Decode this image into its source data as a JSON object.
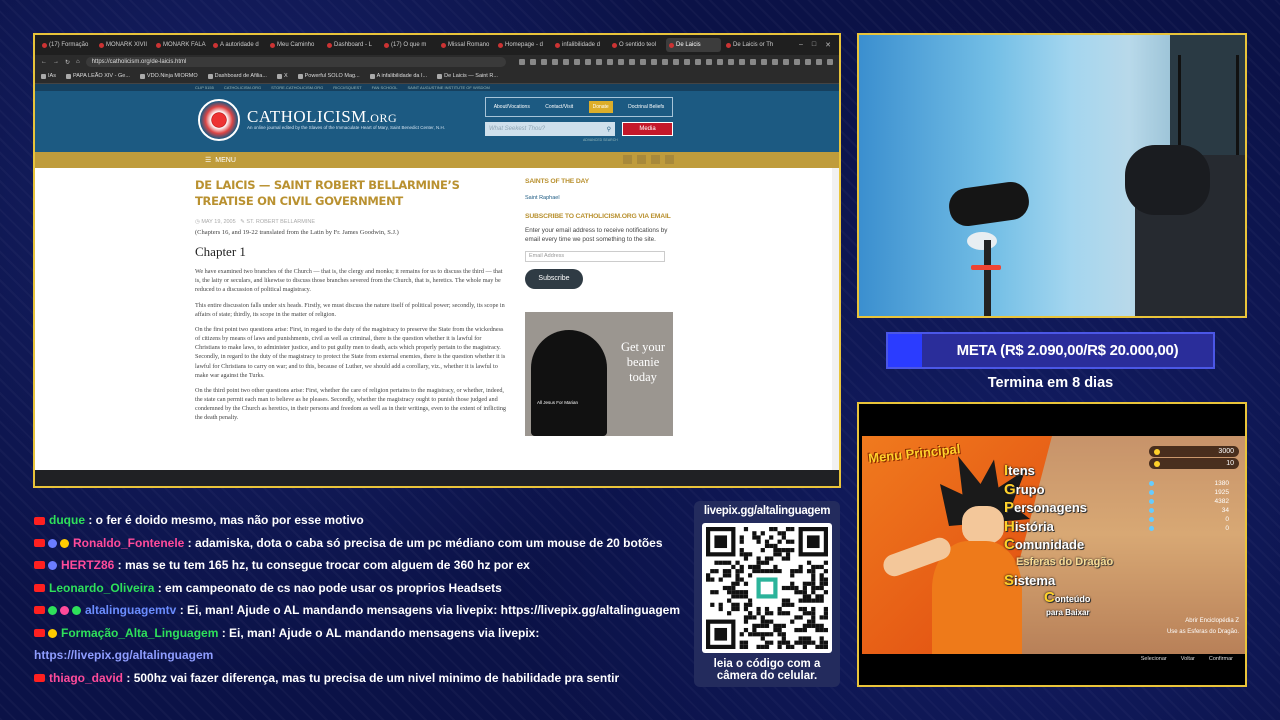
{
  "browser": {
    "tabs": [
      "(17) Formação",
      "MONARK XIVII",
      "MONARK FALA",
      "A autoridade d",
      "Meu Caminho",
      "Dashboard - L",
      "(17) O que m",
      "Missal Romano",
      "Homepage - d",
      "infalibilidade d",
      "O sentido teol",
      "De Laicis",
      "De Laicis or Th"
    ],
    "active_tab_index": 11,
    "url": "https://catholicism.org/de-laicis.html",
    "bookmarks": [
      "IAs",
      "PAPA LEÃO XIV - Ge...",
      "VDO.Ninja MIORMO",
      "Dashboard de Afilia...",
      "X",
      "Powerful SOLO Mag...",
      "A infalibilidade da I...",
      "De Laicis — Saint R..."
    ]
  },
  "site": {
    "top_links": [
      "CLIP 5155",
      "CATHOLICISM.ORG",
      "STORE.CATHOLICISM.ORG",
      "RICCI/SQUEST",
      "FAN SCHOOL",
      "SAINT AUGUSTINE INSTITUTE OF WISDOM"
    ],
    "logo_main": "CATHOLICISM",
    "logo_suffix": ".ORG",
    "logo_sub": "An online journal edited by the Slaves of the Immaculate Heart of Mary, Saint Benedict Center, N.H.",
    "nav": [
      "About/Vocations",
      "Contact/Visit",
      "Donate",
      "Doctrinal Beliefs"
    ],
    "search_placeholder": "What Seekest Thou?",
    "media_label": "Media",
    "advanced_search": "ADVANCED SEARCH",
    "menu_label": "MENU",
    "article": {
      "title": "De Laicis — Saint Robert Bellarmine’s Treatise on Civil Government",
      "date": "MAY 19, 2005",
      "author": "ST. ROBERT BELLARMINE",
      "translation": "(Chapters 16, and 19-22 translated from the Latin by Fr. James Goodwin, S.J.)",
      "chapter": "Chapter 1",
      "paragraphs": [
        "We have examined two branches of the Church — that is, the clergy and monks; it remains for us to discuss the third — that is, the laity or seculars, and likewise to discuss those branches severed from the Church, that is, heretics. The whole may be reduced to a discussion of political magistracy.",
        "This entire discussion falls under six heads. Firstly, we must discuss the nature itself of political power; secondly, its scope in affairs of state; thirdly, its scope in the matter of religion.",
        "On the first point two questions arise: First, in regard to the duty of the magistracy to preserve the State from the wickedness of citizens by means of laws and punishments, civil as well as criminal, there is the question whether it is lawful for Christians to make laws, to administer justice, and to put guilty men to death, acts which properly pertain to the magistracy. Secondly, in regard to the duty of the magistracy to protect the State from external enemies, there is the question whether it is lawful for Christians to carry on war; and to this, because of Luther, we should add a corollary, viz., whether it is lawful to make war against the Turks.",
        "On the third point two other questions arise: First, whether the care of religion pertains to the magistracy, or whether, indeed, the state can permit each man to believe as he pleases. Secondly, whether the magistracy ought to punish those judged and condemned by the Church as heretics, in their persons and freedom as well as in their writings, even to the extent of inflicting the death penalty."
      ]
    },
    "sidebar": {
      "saints_heading": "Saints of the Day",
      "saint_link": "Saint Raphael",
      "subscribe_heading": "Subscribe to Catholicism.org via Email",
      "subscribe_text": "Enter your email address to receive notifications by email every time we post something to the site.",
      "email_placeholder": "Email Address",
      "subscribe_button": "Subscribe",
      "ad_text": "Get your beanie today",
      "beanie_label": "All Jesus For Marian"
    }
  },
  "goal": {
    "text": "META (R$ 2.090,00/R$ 20.000,00)",
    "progress": 0.1045,
    "subtext": "Termina em 8 dias"
  },
  "game": {
    "menu_title": "Menu Principal",
    "menu_items": [
      {
        "first": "I",
        "rest": "tens"
      },
      {
        "first": "G",
        "rest": "rupo"
      },
      {
        "first": "P",
        "rest": "ersonagens"
      },
      {
        "first": "H",
        "rest": "istória"
      },
      {
        "first": "C",
        "rest": "omunidade"
      }
    ],
    "selected_item": "Esferas do Dragão",
    "selected_line2": "do Dragão",
    "system_item": {
      "first": "S",
      "rest": "istema"
    },
    "content_item": {
      "first": "C",
      "rest": "onteúdo"
    },
    "content_sub": "para Baixar",
    "currency": [
      {
        "label": "3000"
      },
      {
        "label": "10"
      }
    ],
    "stats": [
      "1380",
      "1925",
      "4382",
      "34",
      "0",
      "0"
    ],
    "encyclopedia": "Abrir Enciclopédia Z",
    "use_spheres": "Use as Esferas do Dragão.",
    "help": [
      "Selecionar",
      "Voltar",
      "Confirmar"
    ]
  },
  "chat": [
    {
      "user": "duque",
      "color": "#2ee05a",
      "badges": [],
      "text": "o fer é doido mesmo, mas não por esse motivo"
    },
    {
      "user": "Ronaldo_Fontenele",
      "color": "#ff4b9a",
      "badges": [
        "#6b7dff",
        "#ffcc00"
      ],
      "text": "adamiska, dota o caba só precisa de um pc médiano com um mouse de 20 botões"
    },
    {
      "user": "HERTZ86",
      "color": "#ff4b9a",
      "badges": [
        "#6b7dff"
      ],
      "text": "mas se tu tem 165 hz, tu consegue trocar com alguem de 360 hz por ex"
    },
    {
      "user": "Leonardo_Oliveira",
      "color": "#2ee05a",
      "badges": [],
      "text": "em campeonato de cs nao pode usar os proprios Headsets"
    },
    {
      "user": "altalinguagemtv",
      "color": "#6b8dff",
      "badges": [
        "#2ee05a",
        "#ff4b9a",
        "#2ee05a"
      ],
      "text": "Ei, man! Ajude o AL mandando mensagens via livepix: https://livepix.gg/altalinguagem"
    },
    {
      "user": "Formação_Alta_Linguagem",
      "color": "#2ee05a",
      "badges": [
        "#ffcc00"
      ],
      "text": "Ei, man! Ajude o AL mandando mensagens via livepix:"
    },
    {
      "user": "",
      "color": "#8f9dff",
      "badges": [],
      "text": "https://livepix.gg/altalinguagem",
      "is_link": true
    },
    {
      "user": "thiago_david",
      "color": "#ff4b9a",
      "badges": [],
      "text": "500hz vai fazer diferença, mas tu precisa de um nivel minimo de habilidade pra sentir"
    }
  ],
  "qr": {
    "title": "livepix.gg/altalinguagem",
    "caption_line1": "leia o código com a",
    "caption_line2": "câmera do celular."
  }
}
